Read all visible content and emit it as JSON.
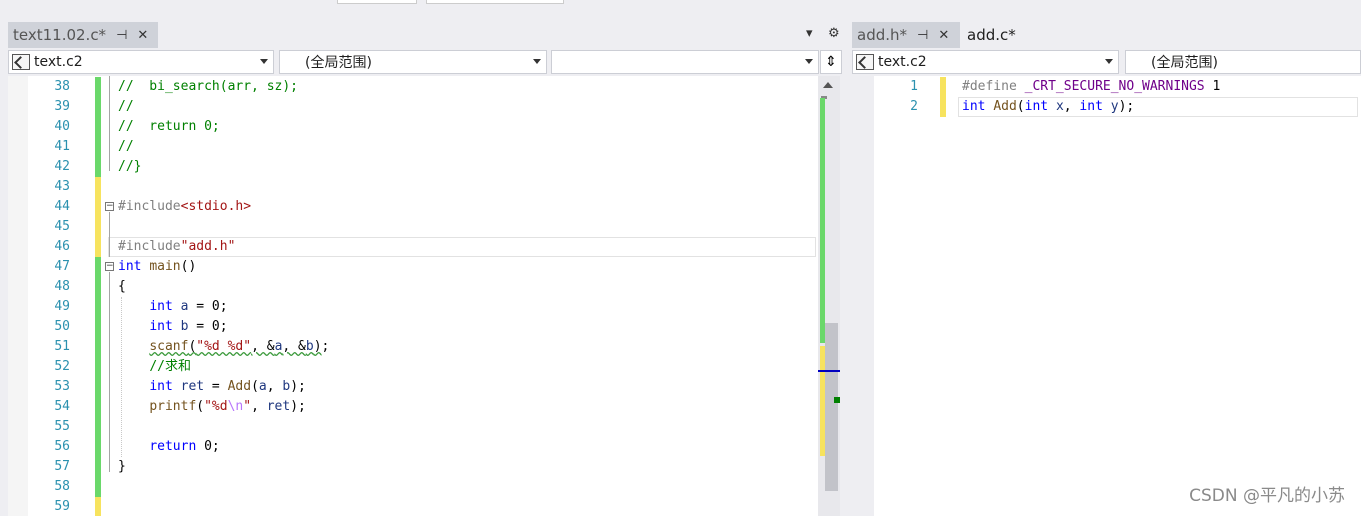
{
  "left": {
    "tab": {
      "title": "text11.02.c*"
    },
    "nav": {
      "project": "text.c2",
      "scope": "(全局范围)",
      "member": ""
    },
    "lines": [
      {
        "n": "38",
        "html": "<span class=\"cmt\">//  bi_search(arr, sz);</span>"
      },
      {
        "n": "39",
        "html": "<span class=\"cmt\">//</span>"
      },
      {
        "n": "40",
        "html": "<span class=\"cmt\">//  return 0;</span>"
      },
      {
        "n": "41",
        "html": "<span class=\"cmt\">//</span>"
      },
      {
        "n": "42",
        "html": "<span class=\"cmt\">//}</span>"
      },
      {
        "n": "43",
        "html": ""
      },
      {
        "n": "44",
        "html": "<span class=\"pp\">#include</span><span class=\"str\">&lt;stdio.h&gt;</span>"
      },
      {
        "n": "45",
        "html": ""
      },
      {
        "n": "46",
        "html": "<span class=\"pp\">#include</span><span class=\"str\">\"add.h\"</span>"
      },
      {
        "n": "47",
        "html": "<span class=\"kw\">int</span> <span class=\"fn\">main</span>()"
      },
      {
        "n": "48",
        "html": "{"
      },
      {
        "n": "49",
        "html": "    <span class=\"kw\">int</span> <span class=\"var\">a</span> = 0;"
      },
      {
        "n": "50",
        "html": "    <span class=\"kw\">int</span> <span class=\"var\">b</span> = 0;"
      },
      {
        "n": "51",
        "html": "    <span class=\"squig\"><span class=\"fn\">scanf</span>(<span class=\"str\">\"%d %d\"</span>, &amp;<span class=\"var\">a</span>, &amp;<span class=\"var\">b</span>)</span>;"
      },
      {
        "n": "52",
        "html": "    <span class=\"cmt\">//求和</span>"
      },
      {
        "n": "53",
        "html": "    <span class=\"kw\">int</span> <span class=\"var\">ret</span> = <span class=\"fn\">Add</span>(<span class=\"var\">a</span>, <span class=\"var\">b</span>);"
      },
      {
        "n": "54",
        "html": "    <span class=\"fn\">printf</span>(<span class=\"str\">\"%d<span class=\"esc\">\\n</span>\"</span>, <span class=\"var\">ret</span>);"
      },
      {
        "n": "55",
        "html": ""
      },
      {
        "n": "56",
        "html": "    <span class=\"kw\">return</span> 0;"
      },
      {
        "n": "57",
        "html": "}"
      },
      {
        "n": "58",
        "html": ""
      },
      {
        "n": "59",
        "html": ""
      }
    ]
  },
  "right": {
    "tabs": [
      {
        "title": "add.h*"
      },
      {
        "title": "add.c*"
      }
    ],
    "nav": {
      "project": "text.c2",
      "scope": "(全局范围)"
    },
    "lines": [
      {
        "n": "1",
        "html": "<span class=\"pp\">#define</span> <span class=\"mac\">_CRT_SECURE_NO_WARNINGS</span> 1"
      },
      {
        "n": "2",
        "html": "<span class=\"kw\">int</span> <span class=\"fn\">Add</span>(<span class=\"kw\">int</span> <span class=\"var\">x</span>, <span class=\"kw\">int</span> <span class=\"var\">y</span>);"
      }
    ]
  },
  "watermark": "CSDN @平凡的小苏",
  "colors": {
    "change_saved": "#6ad86a",
    "change_unsaved": "#f7e35e",
    "line_number": "#2b91af",
    "keyword": "#0000ff",
    "comment": "#008000",
    "string": "#a31515"
  }
}
